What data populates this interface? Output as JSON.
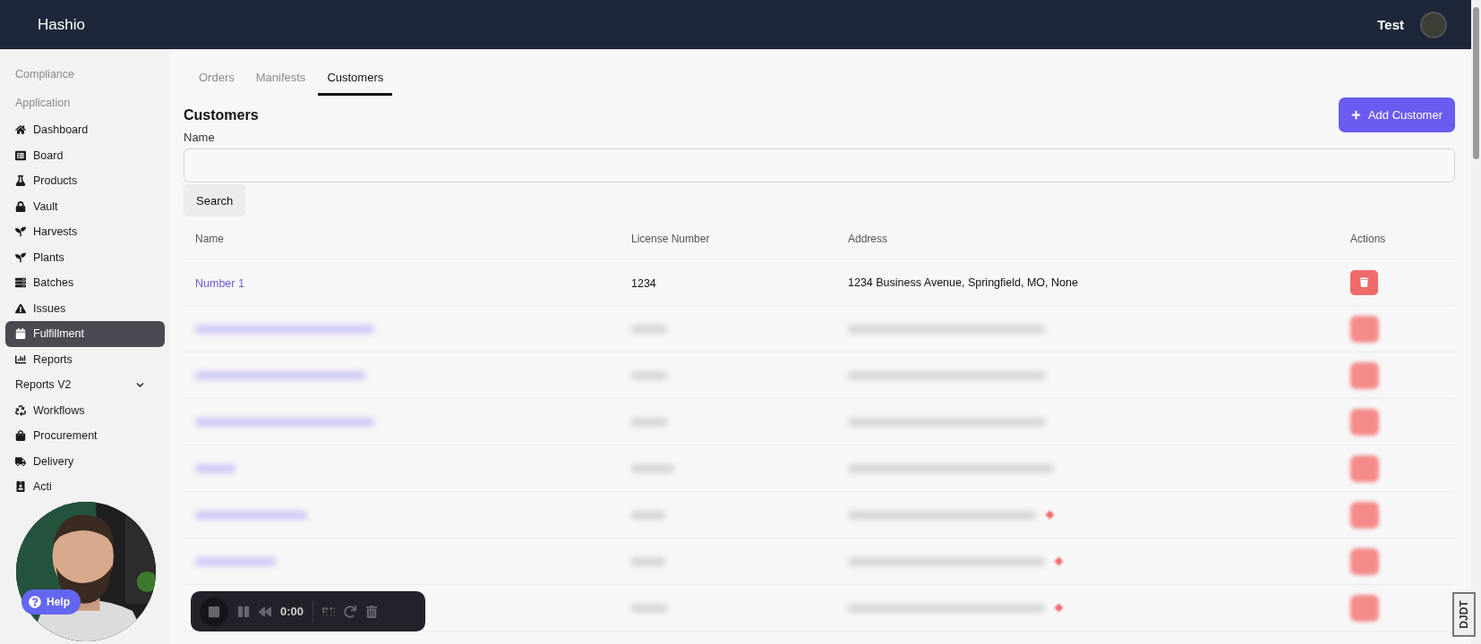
{
  "header": {
    "brand": "Hashio",
    "user": "Test"
  },
  "sidebar": {
    "sections": [
      "Compliance",
      "Application"
    ],
    "items": [
      {
        "kind": "link",
        "label": "Dashboard",
        "selected": false
      },
      {
        "kind": "link",
        "label": "Board",
        "selected": false
      },
      {
        "kind": "link",
        "label": "Products",
        "selected": false
      },
      {
        "kind": "link",
        "label": "Vault",
        "selected": false
      },
      {
        "kind": "link",
        "label": "Harvests",
        "selected": false
      },
      {
        "kind": "link",
        "label": "Plants",
        "selected": false
      },
      {
        "kind": "link",
        "label": "Batches",
        "selected": false
      },
      {
        "kind": "link",
        "label": "Issues",
        "selected": false
      },
      {
        "kind": "link",
        "label": "Fulfillment",
        "selected": true
      },
      {
        "kind": "link",
        "label": "Reports",
        "selected": false
      },
      {
        "kind": "group",
        "label": "Reports V2",
        "selected": false,
        "expanded": false
      },
      {
        "kind": "link",
        "label": "Workflows",
        "selected": false
      },
      {
        "kind": "link",
        "label": "Procurement",
        "selected": false
      },
      {
        "kind": "link",
        "label": "Delivery",
        "selected": false
      },
      {
        "kind": "link",
        "label": "Acti",
        "selected": false
      }
    ]
  },
  "tabs": [
    {
      "label": "Orders",
      "selected": false
    },
    {
      "label": "Manifests",
      "selected": false
    },
    {
      "label": "Customers",
      "selected": true
    }
  ],
  "page": {
    "title": "Customers",
    "add_button": "Add Customer",
    "filter_label": "Name",
    "search_button": "Search"
  },
  "table": {
    "columns": [
      "Name",
      "License Number",
      "Address",
      "Actions"
    ],
    "rows": [
      {
        "kind": "plain",
        "name": "Number 1",
        "license": "1234",
        "address": "1234 Business Avenue, Springfield, MO, None",
        "flag": false
      },
      {
        "kind": "blurred",
        "flag": false
      },
      {
        "kind": "blurred",
        "flag": false
      },
      {
        "kind": "blurred",
        "flag": false
      },
      {
        "kind": "blurred",
        "flag": false
      },
      {
        "kind": "blurred",
        "flag": true
      },
      {
        "kind": "blurred",
        "flag": true
      },
      {
        "kind": "blurred",
        "flag": true
      }
    ]
  },
  "webcam": {
    "kind": "picture",
    "help_button": "Help"
  },
  "recorder": {
    "time": "0:00"
  },
  "debug_badge": "DJDT"
}
